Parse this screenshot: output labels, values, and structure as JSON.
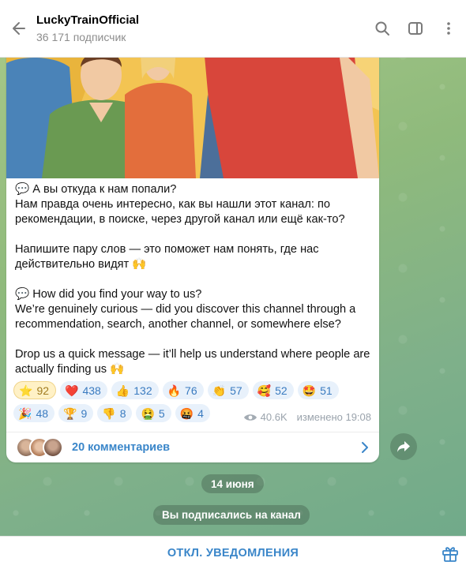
{
  "header": {
    "title": "LuckyTrainOfficial",
    "subscribers": "36 171 подписчик"
  },
  "message": {
    "paragraphs": [
      "💬 А вы откуда к нам попали?\nНам правда очень интересно, как вы нашли этот канал: по рекомендации, в поиске, через другой канал или ещё как-то?",
      "Напишите пару слов — это поможет нам понять, где нас действительно видят 🙌",
      "💬 How did you find your way to us?\nWe’re genuinely curious — did you discover this channel through a recommendation, search, another channel, or somewhere else?",
      "Drop us a quick message — it’ll help us understand where people are actually finding us 🙌"
    ],
    "reactions_row1": [
      {
        "emoji": "⭐",
        "count": "92",
        "active": true
      },
      {
        "emoji": "❤️",
        "count": "438"
      },
      {
        "emoji": "👍",
        "count": "132"
      },
      {
        "emoji": "🔥",
        "count": "76"
      },
      {
        "emoji": "👏",
        "count": "57"
      },
      {
        "emoji": "🥰",
        "count": "52"
      },
      {
        "emoji": "🤩",
        "count": "51"
      }
    ],
    "reactions_row2": [
      {
        "emoji": "🎉",
        "count": "48"
      },
      {
        "emoji": "🏆",
        "count": "9"
      },
      {
        "emoji": "👎",
        "count": "8"
      },
      {
        "emoji": "🤮",
        "count": "5"
      },
      {
        "emoji": "🤬",
        "count": "4"
      }
    ],
    "views": "40.6K",
    "edited": "изменено 19:08",
    "comments_label": "20 комментариев"
  },
  "date_separator": "14 июня",
  "service_message": "Вы подписались на канал",
  "footer": {
    "mute_label": "ОТКЛ. УВЕДОМЛЕНИЯ"
  },
  "colors": {
    "accent": "#3a86c9",
    "bubble": "#ffffff",
    "header": "#ffffff"
  },
  "icons": {
    "back": "arrow-left-icon",
    "search": "search-icon",
    "sidebar": "sidebar-toggle-icon",
    "menu": "more-vertical-icon",
    "views": "eye-icon",
    "comments": "chevron-right-icon",
    "share": "share-icon",
    "gift": "gift-icon"
  }
}
